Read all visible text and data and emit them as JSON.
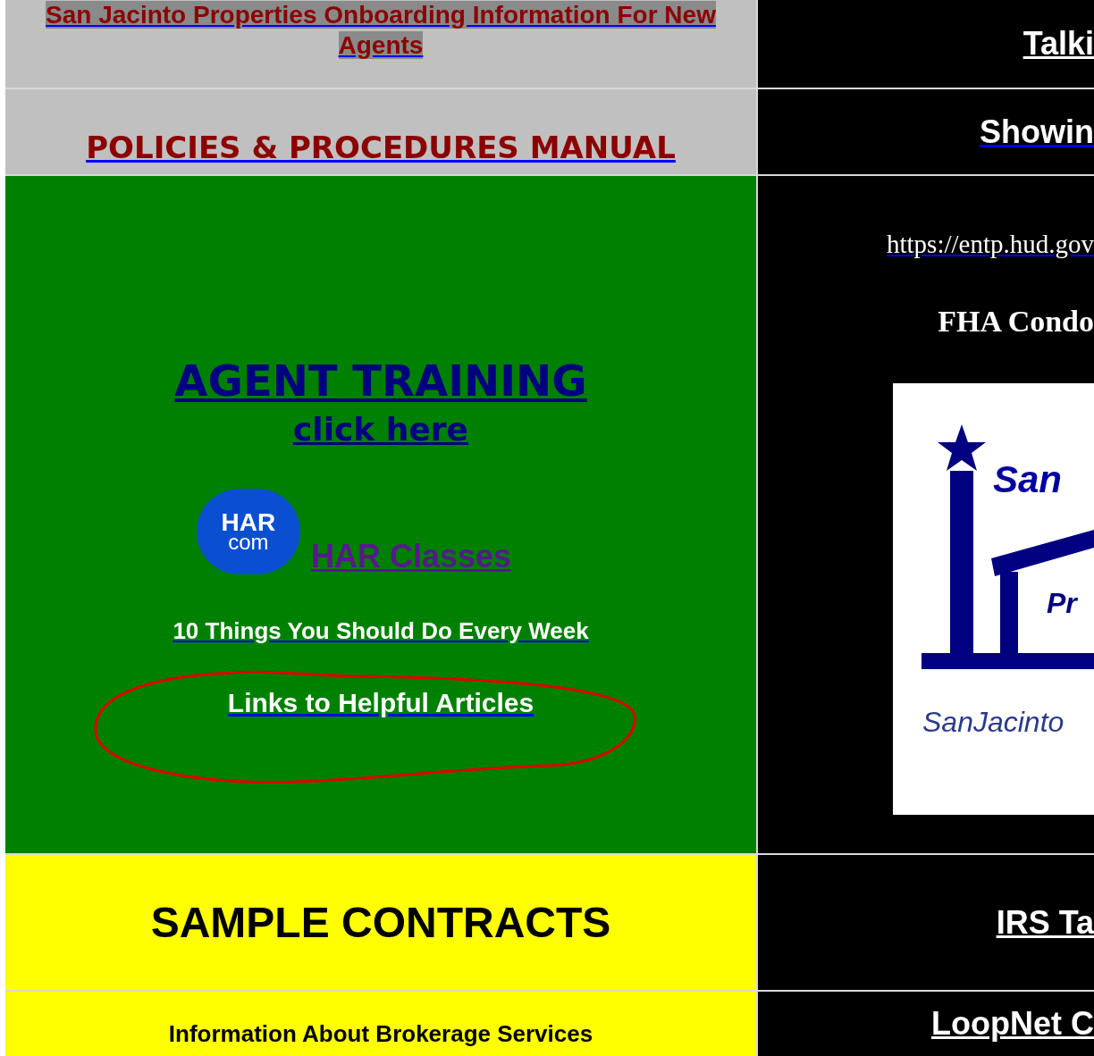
{
  "left": {
    "onboarding_link": "San Jacinto Properties Onboarding Information  For New Agents",
    "policies_link": "POLICIES & PROCEDURES MANUAL",
    "agent_training": {
      "title": "AGENT TRAINING",
      "click_here": "click here"
    },
    "har": {
      "logo_top": "HAR",
      "logo_bottom": "com",
      "link": "HAR Classes"
    },
    "ten_things_link": "10 Things You Should Do Every Week",
    "helpful_articles_link": "Links to Helpful Articles",
    "sample_contracts": "SAMPLE CONTRACTS",
    "brokerage_info": "Information About Brokerage Services"
  },
  "right": {
    "talking_link": "Talki",
    "showing_link": "Showin",
    "hud_url": "https://entp.hud.gov",
    "fha_heading": "FHA Condo",
    "logo": {
      "name_top": "San",
      "name_mid": "Pr",
      "website": "SanJacinto"
    },
    "irs_link": "IRS Ta",
    "loopnet_link": "LoopNet C"
  }
}
